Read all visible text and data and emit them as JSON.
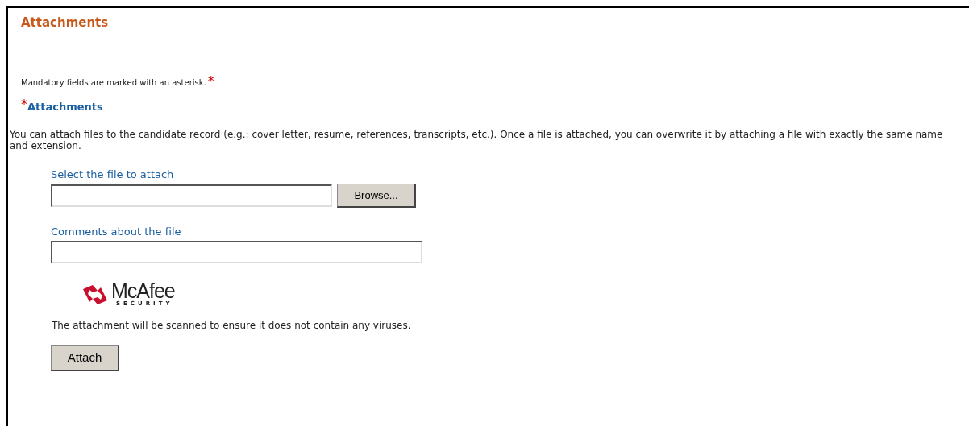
{
  "title": "Attachments",
  "mandatory_note": {
    "text": "Mandatory fields are marked with an asterisk.",
    "marker": "*"
  },
  "section": {
    "marker": "*",
    "title": "Attachments"
  },
  "description": "You can attach files to the candidate record (e.g.: cover letter, resume, references, transcripts, etc.). Once a file is attached, you can overwrite it by attaching a file with exactly the same name and extension.",
  "fields": [
    {
      "kind": "file",
      "label": "Select the file to attach",
      "button": "Browse..."
    },
    {
      "kind": "text",
      "label": "Comments about the file"
    }
  ],
  "logo": {
    "name": "McAfee",
    "tagline": "SECURITY"
  },
  "scan_note": "The attachment will be scanned to ensure it does not contain any viruses.",
  "submit_button": "Attach"
}
